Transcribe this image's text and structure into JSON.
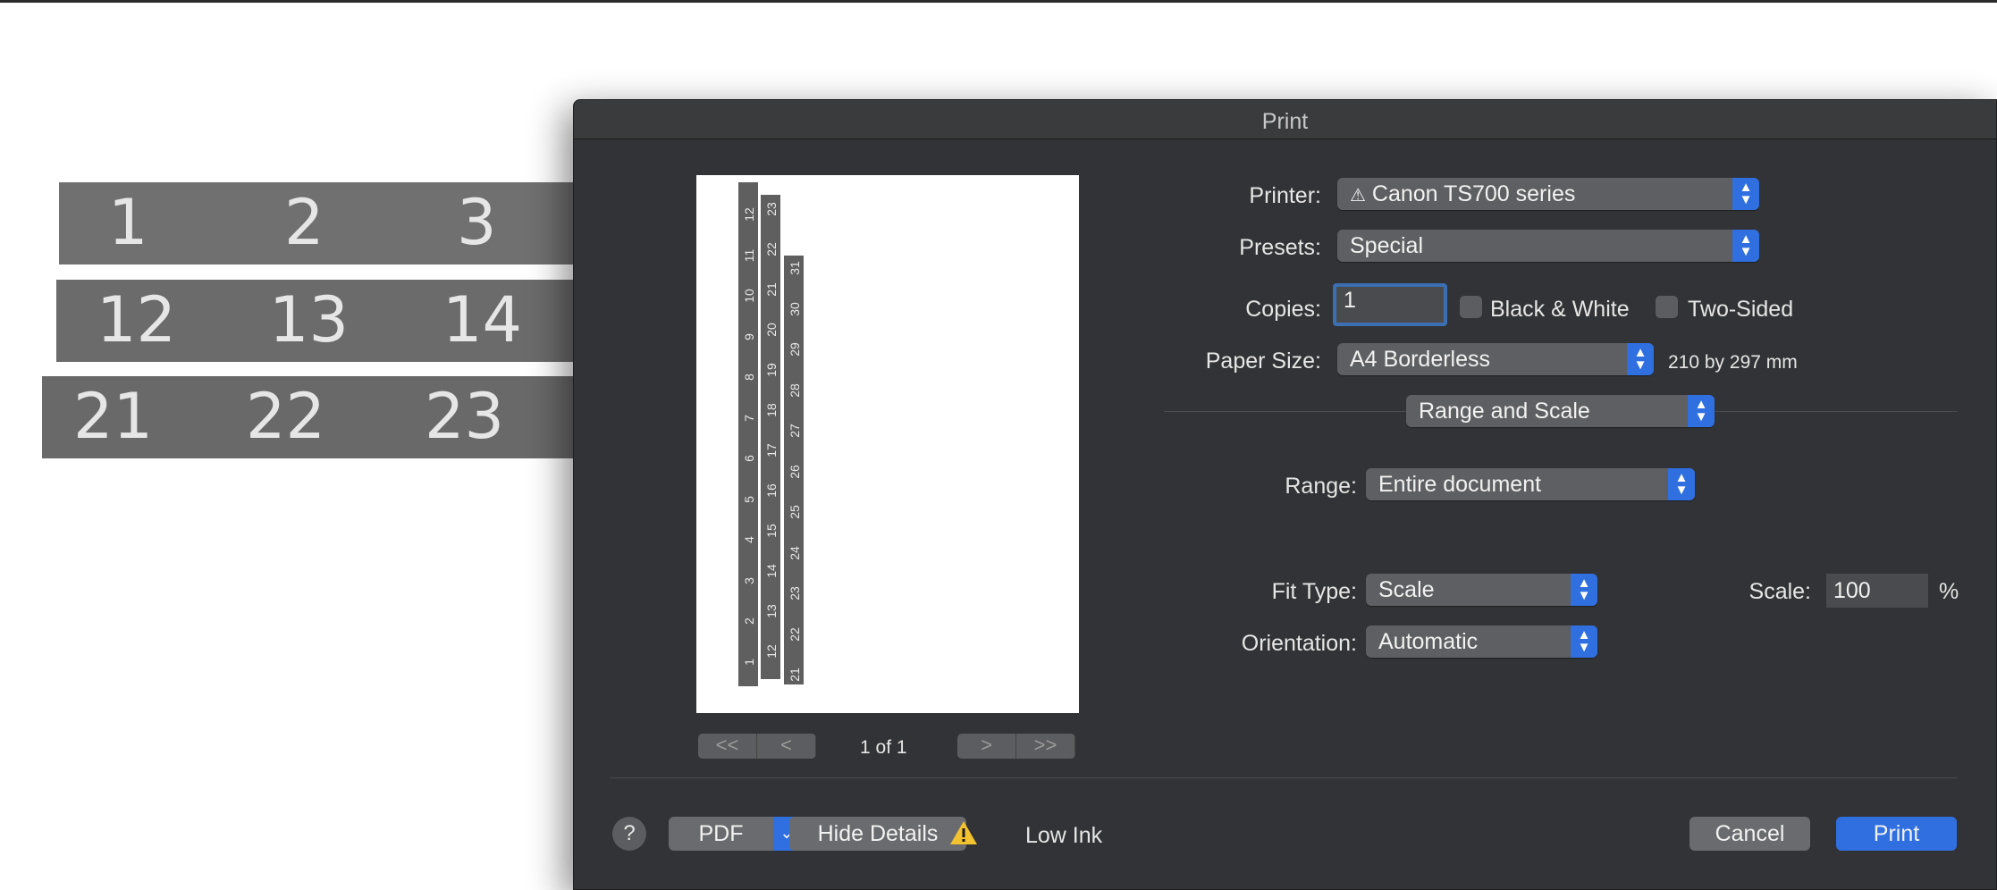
{
  "background": {
    "strip1": [
      "1",
      "2",
      "3"
    ],
    "strip2": [
      "12",
      "13",
      "14"
    ],
    "strip3": [
      "21",
      "22",
      "23"
    ]
  },
  "dialog": {
    "title": "Print",
    "preview": {
      "tape1": [
        "12",
        "11",
        "10",
        "9",
        "8",
        "7",
        "6",
        "5",
        "4",
        "3",
        "2",
        "1"
      ],
      "tape2": [
        "23",
        "22",
        "21",
        "20",
        "19",
        "18",
        "17",
        "16",
        "15",
        "14",
        "13",
        "12"
      ],
      "tape3": [
        "31",
        "30",
        "29",
        "28",
        "27",
        "26",
        "25",
        "24",
        "23",
        "22",
        "21"
      ],
      "page_count": "1 of 1",
      "nav": {
        "first": "<<",
        "prev": "<",
        "next": ">",
        "last": ">>"
      }
    },
    "printer": {
      "label": "Printer:",
      "value": "Canon TS700 series",
      "warning_icon": "warning-icon"
    },
    "presets": {
      "label": "Presets:",
      "value": "Special"
    },
    "copies": {
      "label": "Copies:",
      "value": "1"
    },
    "black_white": {
      "label": "Black & White",
      "checked": false
    },
    "two_sided": {
      "label": "Two-Sided",
      "checked": false
    },
    "paper_size": {
      "label": "Paper Size:",
      "value": "A4 Borderless",
      "dimensions": "210 by 297 mm"
    },
    "section": {
      "value": "Range and Scale"
    },
    "range": {
      "label": "Range:",
      "value": "Entire document"
    },
    "fit_type": {
      "label": "Fit Type:",
      "value": "Scale"
    },
    "scale": {
      "label": "Scale:",
      "value": "100",
      "unit": "%"
    },
    "orientation": {
      "label": "Orientation:",
      "value": "Automatic"
    },
    "footer": {
      "help": "?",
      "pdf": "PDF",
      "hide_details": "Hide Details",
      "low_ink": "Low Ink",
      "cancel": "Cancel",
      "print": "Print"
    }
  }
}
